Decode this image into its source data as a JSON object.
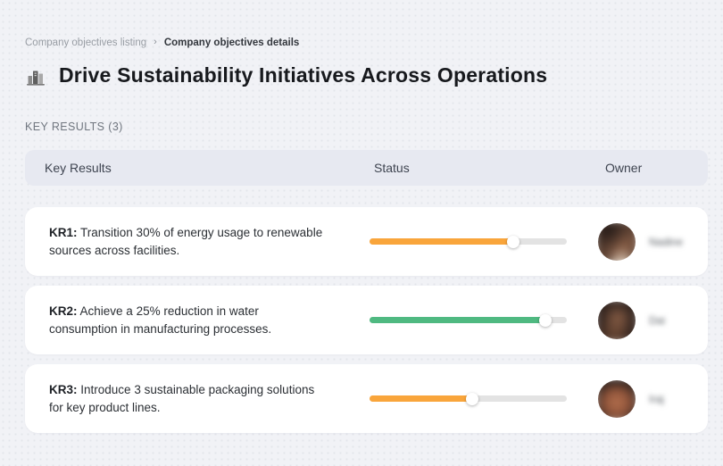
{
  "breadcrumb": {
    "separator": "›",
    "items": [
      {
        "label": "Company objectives listing"
      },
      {
        "label": "Company objectives details"
      }
    ]
  },
  "header": {
    "icon": "city-bar-chart-icon",
    "title": "Drive Sustainability Initiatives Across Operations"
  },
  "section": {
    "label": "KEY RESULTS (3)"
  },
  "table": {
    "columns": {
      "key_results": "Key Results",
      "status": "Status",
      "owner": "Owner"
    }
  },
  "key_results": [
    {
      "id": "KR1:",
      "text": "Transition 30% of energy usage to renewable sources across facilities.",
      "progress_percent": 73,
      "progress_color": "#F9A53B",
      "owner": "Nadine"
    },
    {
      "id": "KR2:",
      "text": "Achieve a 25% reduction in water consumption in manufacturing processes.",
      "progress_percent": 89,
      "progress_color": "#4FB981",
      "owner": "Dai"
    },
    {
      "id": "KR3:",
      "text": "Introduce 3 sustainable packaging solutions for key product lines.",
      "progress_percent": 52,
      "progress_color": "#F9A53B",
      "owner": "Iraj"
    }
  ],
  "colors": {
    "page_bg": "#F1F2F6",
    "card_bg": "#FFFFFF",
    "header_bg": "#E7E9F1",
    "track": "#E3E3E3",
    "accent_orange": "#F9A53B",
    "accent_green": "#4FB981"
  }
}
